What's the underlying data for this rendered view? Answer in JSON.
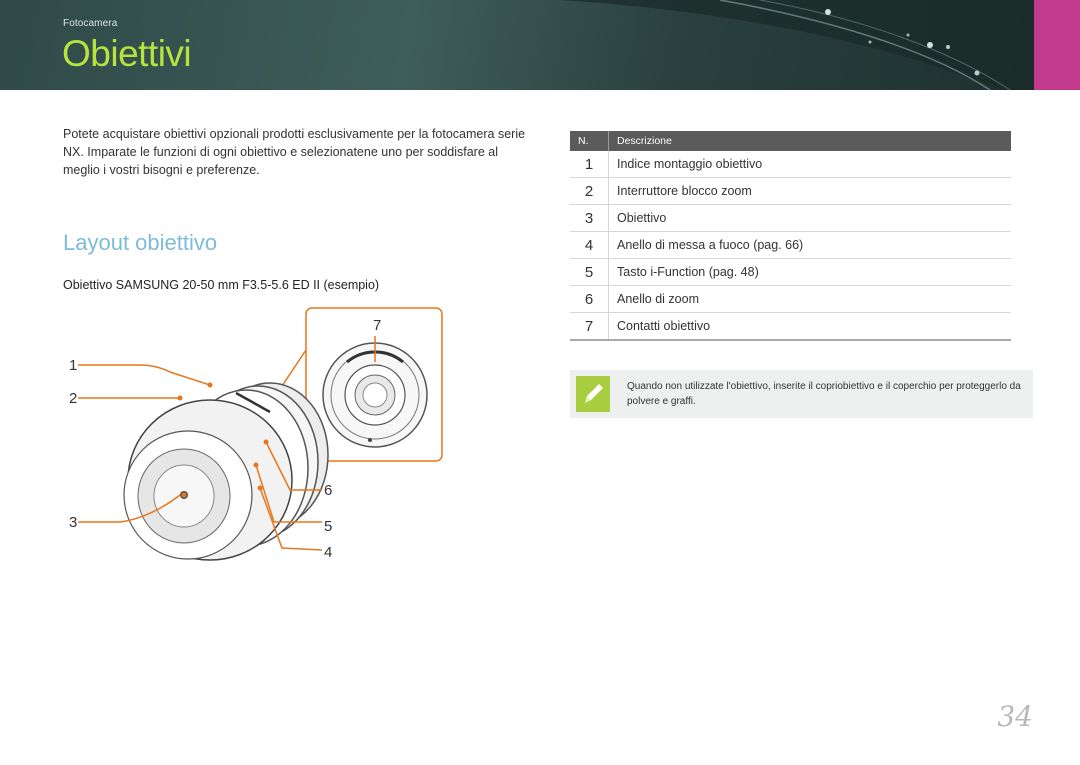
{
  "header": {
    "breadcrumb": "Fotocamera",
    "title": "Obiettivi",
    "title_color": "#b6e33d",
    "accent_color": "#c23a8d"
  },
  "intro": "Potete acquistare obiettivi opzionali prodotti esclusivamente per la fotocamera serie NX. Imparate le funzioni di ogni obiettivo e selezionatene uno per soddisfare al meglio i vostri bisogni e preferenze.",
  "section": {
    "title": "Layout obiettivo",
    "title_color": "#7dbcd9",
    "lens_caption": "Obiettivo SAMSUNG 20-50 mm F3.5-5.6 ED II (esempio)"
  },
  "diagram": {
    "callouts": [
      "1",
      "2",
      "3",
      "4",
      "5",
      "6",
      "7"
    ],
    "callout_line_color": "#e8761c"
  },
  "table": {
    "headers": [
      "N.",
      "Descrizione"
    ],
    "rows": [
      {
        "n": "1",
        "desc": "Indice montaggio obiettivo"
      },
      {
        "n": "2",
        "desc": "Interruttore blocco zoom"
      },
      {
        "n": "3",
        "desc": "Obiettivo"
      },
      {
        "n": "4",
        "desc": "Anello di messa a fuoco (pag. 66)"
      },
      {
        "n": "5",
        "desc": "Tasto i-Function (pag. 48)"
      },
      {
        "n": "6",
        "desc": "Anello di zoom"
      },
      {
        "n": "7",
        "desc": "Contatti obiettivo"
      }
    ]
  },
  "note": {
    "icon": "pencil-note-icon",
    "text": "Quando non utilizzate l'obiettivo, inserite il copriobiettivo e il coperchio per proteggerlo da polvere e graffi."
  },
  "page_number": "34"
}
